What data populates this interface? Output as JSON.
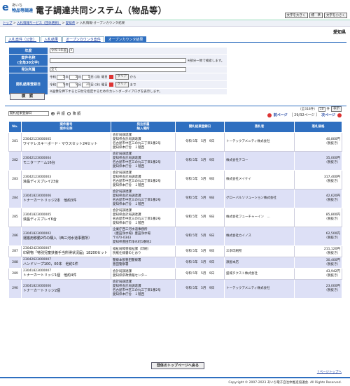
{
  "header": {
    "logo_mark": "e",
    "logo_sub": "あいち",
    "logo_name": "物品等調達",
    "title": "電子調達共同システム（物品等）",
    "font_buttons": [
      "文字を大きく",
      "標　準",
      "文字を小さく"
    ]
  },
  "breadcrumb": {
    "items": [
      "トップ",
      "入札情報サービス（団体選択）",
      "愛知県",
      "入札情報-オープンカウンタ結果"
    ]
  },
  "prefecture": "愛知県",
  "tabs": [
    "入札案件（公告）",
    "入札結果",
    "オープンカウンタ案件",
    "オープンカウンタ結果"
  ],
  "search": {
    "year_label": "年度",
    "year_value": "令和 5年度",
    "case_label": "案件名称",
    "case_sub": "(全角30文字)",
    "case_note": "※部分一致で検索します。",
    "org_label": "発注所属",
    "org_value": "全て",
    "date_label": "開札結果登録日",
    "era": "令和",
    "from": {
      "y": "5",
      "m": "5",
      "d": "1",
      "dow": "(月)"
    },
    "to": {
      "y": "5",
      "m": "5",
      "d": "31",
      "dow": "(水)"
    },
    "dow_label": "曜日",
    "clear": "クリア",
    "from_suffix": "から",
    "to_suffix": "まで",
    "date_note": "※画像を押下すると日付を指定するためのカレンダーダイアログを表示します。",
    "button": "検　索"
  },
  "pager": {
    "total": "（全318件）",
    "per_page": "10",
    "per_suffix": "件",
    "display_btn": "表示",
    "sort_value": "開札結果登録日",
    "asc": "昇 順",
    "desc": "降 順",
    "prev": "前ページ",
    "page_info": "［ 29/32ページ ］",
    "next": "次ページ"
  },
  "table": {
    "headers": [
      "No.",
      "案件番号\n案件名称",
      "発注所属\n納入場所",
      "開札結果登録日",
      "落札者",
      "落札価格"
    ],
    "rows": [
      {
        "no": "281",
        "id": "23042123000005",
        "name": "ワイヤレスキーボード・マウスセット24セット",
        "dept": "会計局調達課",
        "place": [
          "愛知県会計局調達課",
          "名古屋市中区三の丸三丁目1番2号",
          "愛知県本庁舎　１階西"
        ],
        "date": "令和 5年　5月　9日",
        "winner": "トーテックアメニティ株式会社",
        "price": "40,800円",
        "tax": "（税抜き）"
      },
      {
        "no": "282",
        "id": "23042123000004",
        "name": "モニターアーム16台",
        "dept": "会計局調達課",
        "place": [
          "愛知県会計局調達課",
          "名古屋市中区三の丸三丁目1番2号",
          "愛知県本庁舎　１階西"
        ],
        "date": "令和 5年　5月　9日",
        "winner": "株式会社テコー",
        "price": "35,000円",
        "tax": "（税抜き）"
      },
      {
        "no": "283",
        "id": "23042123000003",
        "name": "液晶ディスプレイ23台",
        "dept": "会計局調達課",
        "place": [
          "愛知県会計局調達課",
          "名古屋市中区三の丸三丁目1番2号",
          "愛知県本庁舎　１階西"
        ],
        "date": "令和 5年　5月　9日",
        "winner": "株式会社メイケイ",
        "price": "317,400円",
        "tax": "（税抜き）"
      },
      {
        "no": "284",
        "id": "23041823000006",
        "name": "トナーカートリッジ2本　他約3件",
        "dept": "会計局調達課",
        "place": [
          "愛知県会計局調達課",
          "名古屋市中区三の丸三丁目1番2号",
          "愛知県本庁舎　１階西"
        ],
        "date": "令和 5年　5月　9日",
        "winner": "グローバルソリューション株式会社",
        "price": "42,620円",
        "tax": "（税抜き）"
      },
      {
        "no": "285",
        "id": "23041823000005",
        "name": "液晶ディスプレイ6台",
        "dept": "会計局調達課",
        "place": [
          "愛知県会計局調達課",
          "名古屋市中区三の丸三丁目1番2号",
          "愛知県本庁舎　１階西"
        ],
        "date": "令和 5年　5月　9日",
        "winner": "株式会社フューチャーイン　…",
        "price": "85,800円",
        "tax": "（税抜き）"
      },
      {
        "no": "286",
        "id": "23041823000002",
        "name": "運搬用移動2件の購入（西三河水道事務所）",
        "dept": "企業庁西三河水道事務所",
        "place": [
          "《豊田浄水場》豊田浄水場",
          "〒470-0343",
          "愛知県豊田市浄水町1番地2"
        ],
        "date": "令和 5年　5月　9日",
        "winner": "株式会社カイノス",
        "price": "62,500円",
        "tax": "（税抜き）"
      },
      {
        "no": "287",
        "id": "23042423000007",
        "name": "印刷物「特別児童扶養手当所得状況届」18200セット",
        "dept": "福祉局障害福祉課（印刷）",
        "place": [
          "別紙仕様書のとおり"
        ],
        "date": "令和 5年　5月　9日",
        "winner": "三幸印刷所",
        "price": "211,120円",
        "tax": "（税抜き）"
      },
      {
        "no": "288",
        "id": "23042623000007",
        "name": "ハンドソープ100，00本　他約1件",
        "dept": "警察本部豊田警察署",
        "place": [
          "豊田警察署"
        ],
        "date": "令和 5年　5月　9日",
        "winner": "源屋本店",
        "price": "30,400円",
        "tax": "（税抜き）"
      },
      {
        "no": "289",
        "id": "23041823000007",
        "name": "トナーカートリッジ1個　他約4件",
        "dept": "会計局調達課",
        "place": [
          "愛知県県政情報センター"
        ],
        "date": "令和 5年　5月　9日",
        "winner": "盛城タクスト株式会社",
        "price": "43,942円",
        "tax": "（税抜き）"
      },
      {
        "no": "290",
        "id": "23041823000006",
        "name": "トナーカートリッジ2個",
        "dept": "会計局調達課",
        "place": [
          "愛知県会計局調達課",
          "名古屋市中区三の丸三丁目1番2号",
          "愛知県本庁舎　１階西"
        ],
        "date": "令和 5年　5月　9日",
        "winner": "トーテックアメニティ株式会社",
        "price": "23,000円",
        "tax": "（税抜き）"
      }
    ]
  },
  "bottom_button": "団体のトップページへ戻る",
  "top_link": "↑ページトップへ",
  "footer": "Copyright © 2007-2023 あいち電子自治体推進協議会. All Rights Reserved."
}
